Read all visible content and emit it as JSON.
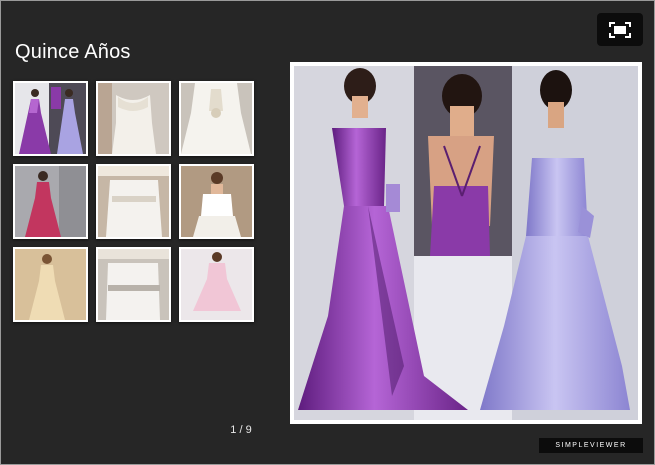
{
  "gallery": {
    "title": "Quince Años",
    "counter": "1 / 9",
    "brand": "SIMPLEVIEWER"
  },
  "icons": {
    "fullscreen": "fullscreen-icon"
  },
  "thumbnails": [
    {
      "name": "thumb-purple-lavender-gowns",
      "bg": "#e6e6ea",
      "dress": "#8a3aa8",
      "selected": true
    },
    {
      "name": "thumb-ivory-sweetheart-bodice",
      "bg": "#cfc8c0",
      "dress": "#f3f0ea"
    },
    {
      "name": "thumb-ivory-lace-back",
      "bg": "#c9c3bb",
      "dress": "#f5f3ee"
    },
    {
      "name": "thumb-pink-satin-gown",
      "bg": "#a9a9ae",
      "dress": "#c2365f"
    },
    {
      "name": "thumb-empire-waist-detail",
      "bg": "#c6b7a6",
      "dress": "#f4f2ee"
    },
    {
      "name": "thumb-white-corset-bodice",
      "bg": "#b19a82",
      "dress": "#ffffff"
    },
    {
      "name": "thumb-champagne-gown",
      "bg": "#d8c09a",
      "dress": "#efdcb4"
    },
    {
      "name": "thumb-belted-sash-detail",
      "bg": "#c9c3bb",
      "dress": "#f4f2ef"
    },
    {
      "name": "thumb-pink-tulle-dress",
      "bg": "#ece7ea",
      "dress": "#f1c6d6"
    }
  ],
  "colors": {
    "background": "#262626",
    "accent_purple": "#8a3aa8",
    "accent_lavender": "#a9a3e2"
  }
}
